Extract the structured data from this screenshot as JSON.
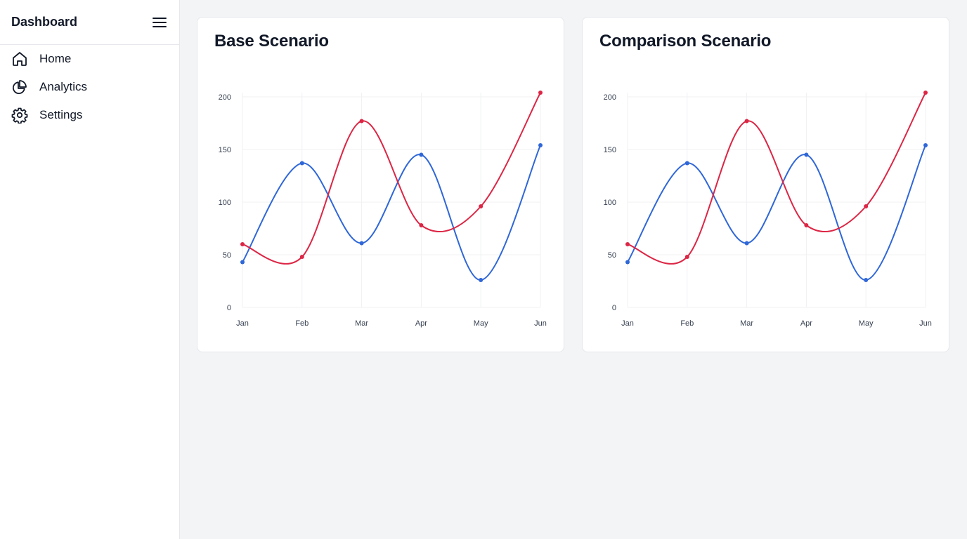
{
  "sidebar": {
    "title": "Dashboard",
    "menu_icon": "hamburger-menu-icon",
    "items": [
      {
        "label": "Home",
        "icon": "home-icon"
      },
      {
        "label": "Analytics",
        "icon": "pie-chart-icon"
      },
      {
        "label": "Settings",
        "icon": "gear-icon"
      }
    ]
  },
  "colors": {
    "series_red": "#dc2645",
    "series_blue": "#2f67d8",
    "grid": "#f0f1f3"
  },
  "cards": [
    {
      "title": "Base Scenario"
    },
    {
      "title": "Comparison Scenario"
    }
  ],
  "chart_data": [
    {
      "type": "line",
      "title": "Base Scenario",
      "categories": [
        "Jan",
        "Feb",
        "Mar",
        "Apr",
        "May",
        "Jun"
      ],
      "ylim": [
        0,
        200
      ],
      "yticks": [
        0,
        50,
        100,
        150,
        200
      ],
      "grid": true,
      "legend": "none",
      "series": [
        {
          "values": [
            43,
            137,
            61,
            145,
            26,
            154
          ],
          "color": "#2f67d8"
        },
        {
          "values": [
            60,
            48,
            177,
            78,
            96,
            204
          ],
          "color": "#dc2645"
        }
      ]
    },
    {
      "type": "line",
      "title": "Comparison Scenario",
      "categories": [
        "Jan",
        "Feb",
        "Mar",
        "Apr",
        "May",
        "Jun"
      ],
      "ylim": [
        0,
        200
      ],
      "yticks": [
        0,
        50,
        100,
        150,
        200
      ],
      "grid": true,
      "legend": "none",
      "series": [
        {
          "values": [
            43,
            137,
            61,
            145,
            26,
            154
          ],
          "color": "#2f67d8"
        },
        {
          "values": [
            60,
            48,
            177,
            78,
            96,
            204
          ],
          "color": "#dc2645"
        }
      ]
    }
  ]
}
